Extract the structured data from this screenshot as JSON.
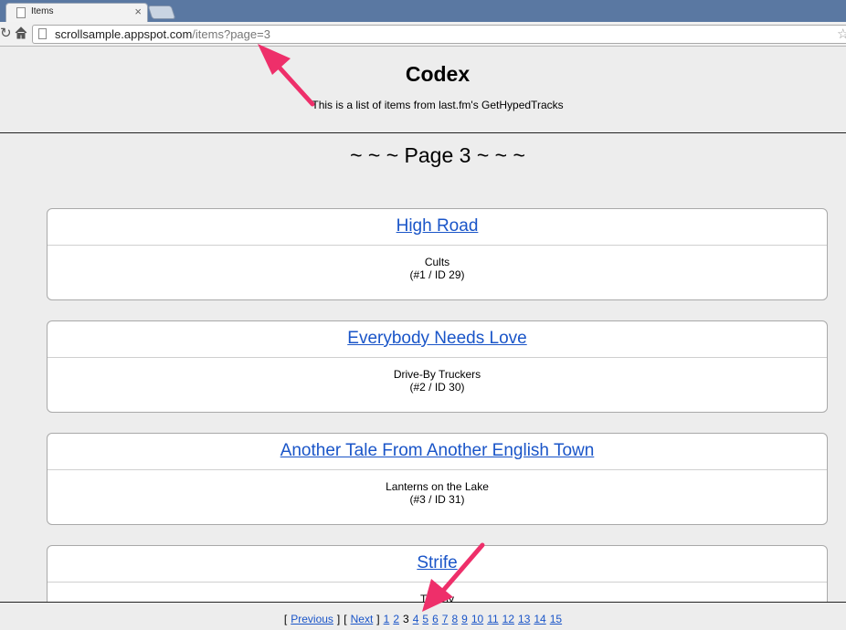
{
  "browser": {
    "tab_title": "Items",
    "tab_close": "×",
    "url_host": "scrollsample.appspot.com",
    "url_path": "/items?page=3"
  },
  "header": {
    "title": "Codex",
    "subtitle": "This is a list of items from last.fm's GetHypedTracks"
  },
  "page_heading": "~ ~ ~ Page 3 ~ ~ ~",
  "items": [
    {
      "title": "High Road",
      "artist": "Cults",
      "meta": "(#1 / ID 29)"
    },
    {
      "title": "Everybody Needs Love",
      "artist": "Drive-By Truckers",
      "meta": "(#2 / ID 30)"
    },
    {
      "title": "Another Tale From Another English Town",
      "artist": "Lanterns on the Lake",
      "meta": "(#3 / ID 31)"
    },
    {
      "title": "Strife",
      "artist": "Trophy",
      "meta": ""
    }
  ],
  "pager": {
    "open_bracket": "[",
    "close_bracket": "]",
    "previous": "Previous",
    "next": "Next",
    "pages": [
      "1",
      "2",
      "3",
      "4",
      "5",
      "6",
      "7",
      "8",
      "9",
      "10",
      "11",
      "12",
      "13",
      "14",
      "15"
    ],
    "current_page": "3"
  },
  "colors": {
    "link": "#1a55c8",
    "annotation_arrow": "#ee2f6a",
    "tabstrip": "#5a78a2"
  }
}
